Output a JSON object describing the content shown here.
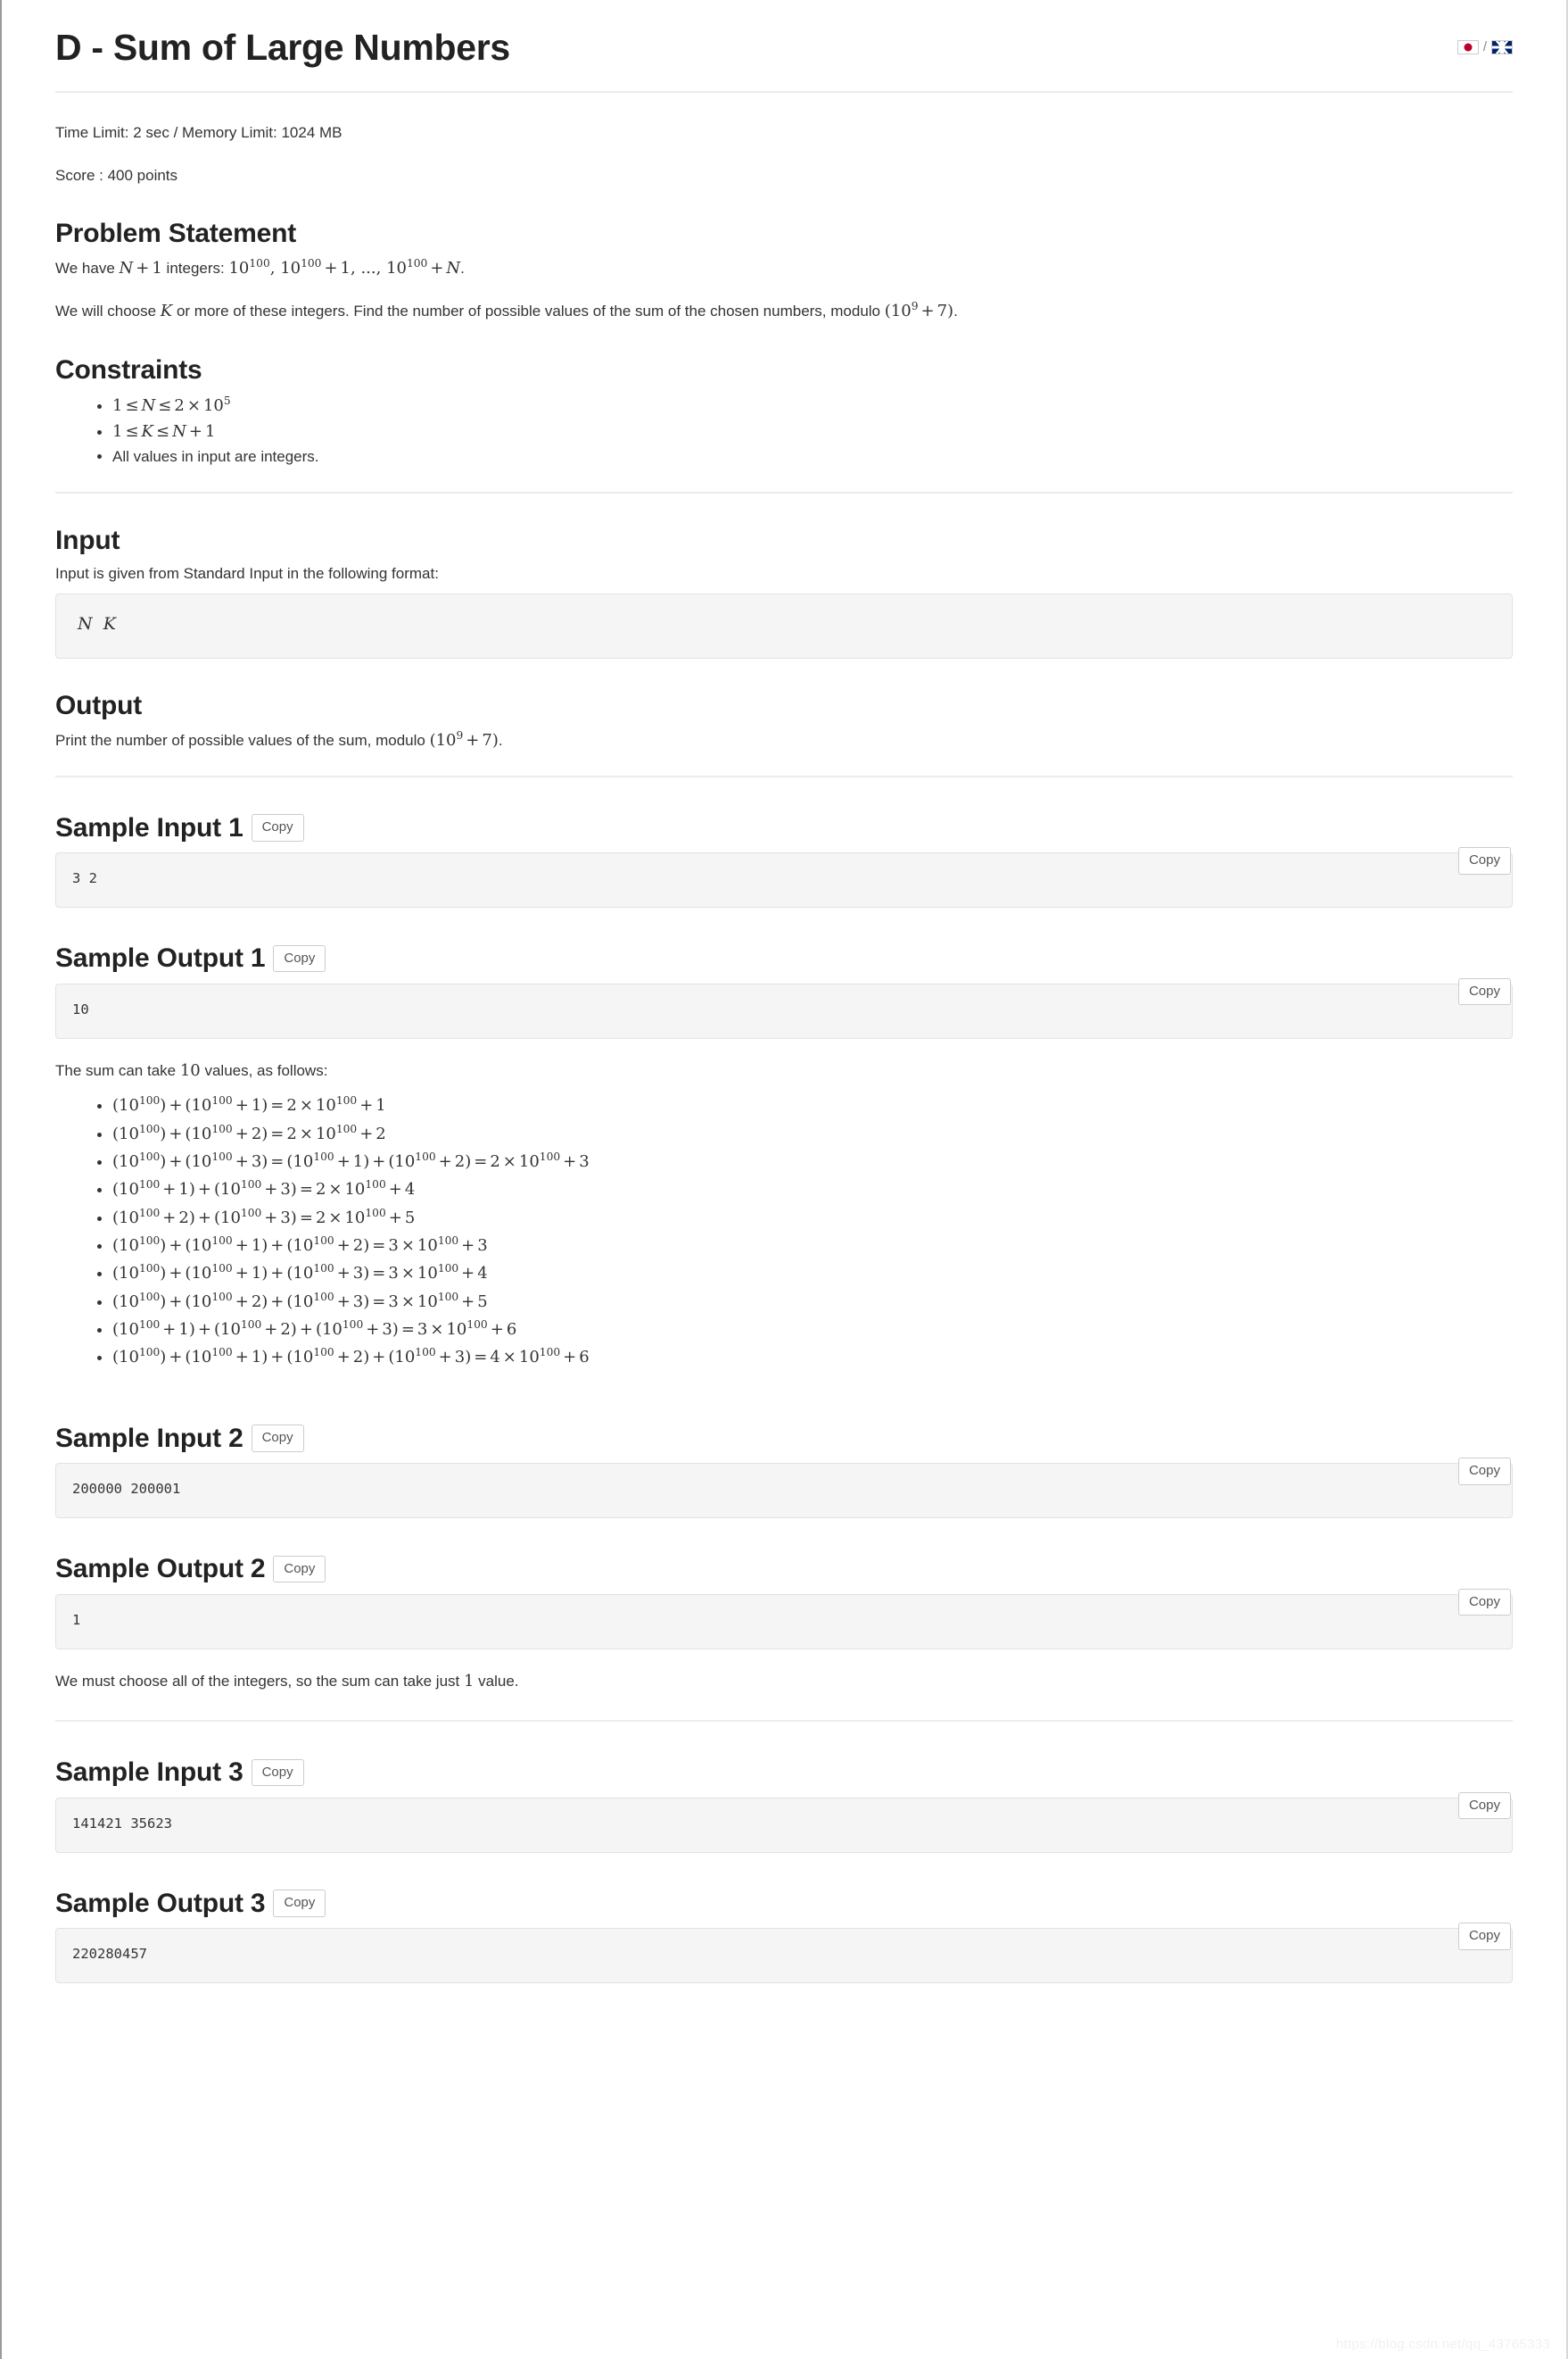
{
  "header": {
    "title": "D - Sum of Large Numbers",
    "lang_jp_icon": "flag-japan-icon",
    "lang_separator": "/",
    "lang_gb_icon": "flag-uk-icon"
  },
  "meta": {
    "limits": "Time Limit: 2 sec / Memory Limit: 1024 MB",
    "score": "Score : 400 points"
  },
  "sections": {
    "problem_statement": {
      "heading": "Problem Statement",
      "para1_pre": "We have ",
      "para1_mid": " integers: ",
      "para1_end": ".",
      "para2_pre": "We will choose ",
      "para2_mid": " or more of these integers. Find the number of possible values of the sum of the chosen numbers, modulo ",
      "para2_end": "."
    },
    "constraints": {
      "heading": "Constraints",
      "item3": "All values in input are integers."
    },
    "input": {
      "heading": "Input",
      "description": "Input is given from Standard Input in the following format:",
      "format_n": "N",
      "format_k": "K"
    },
    "output": {
      "heading": "Output",
      "description_pre": "Print the number of possible values of the sum, modulo ",
      "description_end": "."
    }
  },
  "copy_label": "Copy",
  "samples": [
    {
      "heading": "Sample Input 1",
      "content": "3 2"
    },
    {
      "heading": "Sample Output 1",
      "content": "10"
    },
    {
      "heading": "Sample Input 2",
      "content": "200000 200001"
    },
    {
      "heading": "Sample Output 2",
      "content": "1"
    },
    {
      "heading": "Sample Input 3",
      "content": "141421 35623"
    },
    {
      "heading": "Sample Output 3",
      "content": "220280457"
    }
  ],
  "explanations": {
    "sample1_pre": "The sum can take ",
    "sample1_count": "10",
    "sample1_post": " values, as follows:",
    "sample2_pre": "We must choose all of the integers, so the sum can take just ",
    "sample2_count": "1",
    "sample2_post": " value."
  },
  "equations": [
    {
      "terms": [
        "",
        "1"
      ],
      "result_coef": "2",
      "result_add": "1"
    },
    {
      "terms": [
        "",
        "2"
      ],
      "result_coef": "2",
      "result_add": "2"
    },
    {
      "terms": [
        "",
        "3"
      ],
      "alt_terms": [
        "1",
        "2"
      ],
      "result_coef": "2",
      "result_add": "3"
    },
    {
      "terms": [
        "1",
        "3"
      ],
      "result_coef": "2",
      "result_add": "4"
    },
    {
      "terms": [
        "2",
        "3"
      ],
      "result_coef": "2",
      "result_add": "5"
    },
    {
      "terms": [
        "",
        "1",
        "2"
      ],
      "result_coef": "3",
      "result_add": "3"
    },
    {
      "terms": [
        "",
        "1",
        "3"
      ],
      "result_coef": "3",
      "result_add": "4"
    },
    {
      "terms": [
        "",
        "2",
        "3"
      ],
      "result_coef": "3",
      "result_add": "5"
    },
    {
      "terms": [
        "1",
        "2",
        "3"
      ],
      "result_coef": "3",
      "result_add": "6"
    },
    {
      "terms": [
        "",
        "1",
        "2",
        "3"
      ],
      "result_coef": "4",
      "result_add": "6"
    }
  ],
  "watermark": "https://blog.csdn.net/qq_43765333"
}
